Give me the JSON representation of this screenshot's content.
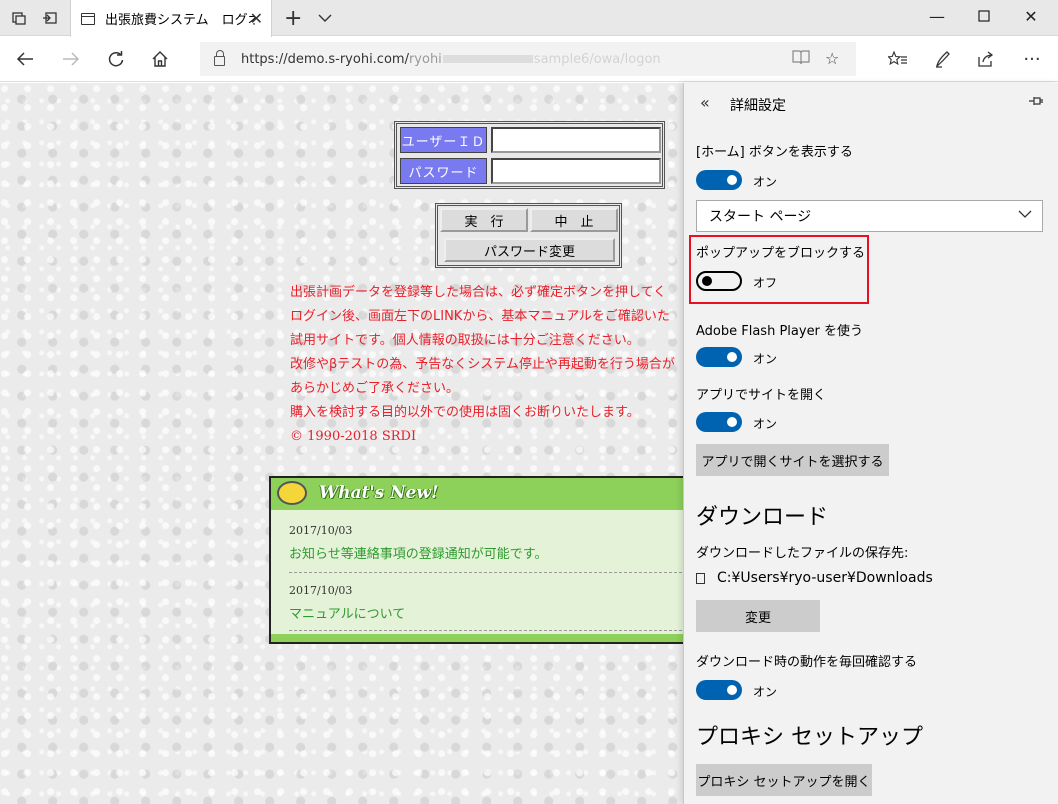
{
  "browser": {
    "tab_title": "出張旅費システム　ログオ",
    "url_host": "https://demo.s-ryohi.com/",
    "url_path_start": "ryohi",
    "url_path_end": "sample6/owa/logon",
    "icons": [
      "tabs-icon",
      "set-aside-icon",
      "close-icon",
      "plus-icon",
      "chevron-down-icon",
      "minimize-icon",
      "maximize-icon",
      "back-icon",
      "forward-icon",
      "refresh-icon",
      "home-icon",
      "lock-icon",
      "reading-view-icon",
      "favorite-star-icon",
      "favorites-list-icon",
      "pen-icon",
      "share-icon",
      "more-icon"
    ]
  },
  "login": {
    "user_id_label": "ユーザーＩＤ",
    "password_label": "パスワード",
    "user_id_value": "",
    "password_value": "",
    "execute_label": "実　行",
    "cancel_label": "中　止",
    "change_password_label": "パスワード変更"
  },
  "notices": [
    "出張計画データを登録等した場合は、必ず確定ボタンを押してく",
    "ログイン後、画面左下のLINKから、基本マニュアルをご確認いた",
    "試用サイトです。個人情報の取扱には十分ご注意ください。",
    "改修やβテストの為、予告なくシステム停止や再起動を行う場合が",
    "あらかじめご了承ください。",
    "購入を検討する目的以外での使用は固くお断りいたします。"
  ],
  "copyright": "© 1990-2018 SRDI",
  "whats_new": {
    "title": "What's New!",
    "items": [
      {
        "date": "2017/10/03",
        "text": "お知らせ等連絡事項の登録通知が可能です。"
      },
      {
        "date": "2017/10/03",
        "text": "マニュアルについて"
      }
    ]
  },
  "settings": {
    "title": "詳細設定",
    "home_button_label": "[ホーム] ボタンを表示する",
    "home_button_state": "オン",
    "start_page_option": "スタート ページ",
    "popup_block_label": "ポップアップをブロックする",
    "popup_block_state": "オフ",
    "flash_label": "Adobe Flash Player を使う",
    "flash_state": "オン",
    "open_in_app_label": "アプリでサイトを開く",
    "open_in_app_state": "オン",
    "choose_sites_button": "アプリで開くサイトを選択する",
    "download_heading": "ダウンロード",
    "download_location_label": "ダウンロードしたファイルの保存先:",
    "download_path": "C:¥Users¥ryo-user¥Downloads",
    "change_button": "変更",
    "ask_download_label": "ダウンロード時の動作を毎回確認する",
    "ask_download_state": "オン",
    "proxy_heading": "プロキシ セットアップ",
    "proxy_button": "プロキシ セットアップを開く"
  },
  "colors": {
    "toggle_on": "#0063b1",
    "highlight_border": "#e81123",
    "notice_red": "#e8202a",
    "label_purple": "#7a7af0",
    "news_green": "#8dd05a"
  }
}
